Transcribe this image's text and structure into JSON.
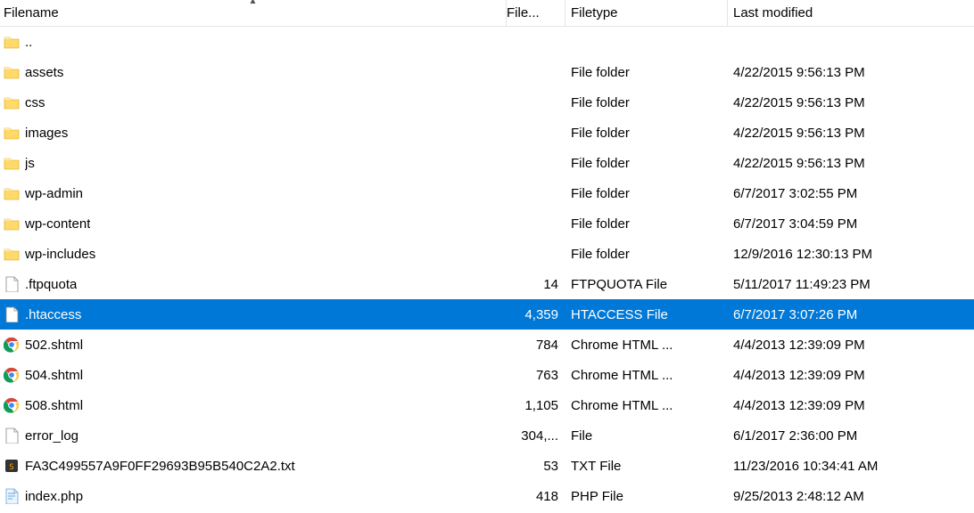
{
  "columns": {
    "filename": "Filename",
    "filesize": "File...",
    "filetype": "Filetype",
    "lastmod": "Last modified"
  },
  "sort_column": "filename",
  "sort_dir": "asc",
  "rows": [
    {
      "icon": "folder",
      "name": "..",
      "size": "",
      "type": "",
      "mod": "",
      "sel": false
    },
    {
      "icon": "folder",
      "name": "assets",
      "size": "",
      "type": "File folder",
      "mod": "4/22/2015 9:56:13 PM",
      "sel": false
    },
    {
      "icon": "folder",
      "name": "css",
      "size": "",
      "type": "File folder",
      "mod": "4/22/2015 9:56:13 PM",
      "sel": false
    },
    {
      "icon": "folder",
      "name": "images",
      "size": "",
      "type": "File folder",
      "mod": "4/22/2015 9:56:13 PM",
      "sel": false
    },
    {
      "icon": "folder",
      "name": "js",
      "size": "",
      "type": "File folder",
      "mod": "4/22/2015 9:56:13 PM",
      "sel": false
    },
    {
      "icon": "folder",
      "name": "wp-admin",
      "size": "",
      "type": "File folder",
      "mod": "6/7/2017 3:02:55 PM",
      "sel": false
    },
    {
      "icon": "folder",
      "name": "wp-content",
      "size": "",
      "type": "File folder",
      "mod": "6/7/2017 3:04:59 PM",
      "sel": false
    },
    {
      "icon": "folder",
      "name": "wp-includes",
      "size": "",
      "type": "File folder",
      "mod": "12/9/2016 12:30:13 PM",
      "sel": false
    },
    {
      "icon": "blank",
      "name": ".ftpquota",
      "size": "14",
      "type": "FTPQUOTA File",
      "mod": "5/11/2017 11:49:23 PM",
      "sel": false
    },
    {
      "icon": "blank",
      "name": ".htaccess",
      "size": "4,359",
      "type": "HTACCESS File",
      "mod": "6/7/2017 3:07:26 PM",
      "sel": true
    },
    {
      "icon": "chrome",
      "name": "502.shtml",
      "size": "784",
      "type": "Chrome HTML ...",
      "mod": "4/4/2013 12:39:09 PM",
      "sel": false
    },
    {
      "icon": "chrome",
      "name": "504.shtml",
      "size": "763",
      "type": "Chrome HTML ...",
      "mod": "4/4/2013 12:39:09 PM",
      "sel": false
    },
    {
      "icon": "chrome",
      "name": "508.shtml",
      "size": "1,105",
      "type": "Chrome HTML ...",
      "mod": "4/4/2013 12:39:09 PM",
      "sel": false
    },
    {
      "icon": "blank",
      "name": "error_log",
      "size": "304,...",
      "type": "File",
      "mod": "6/1/2017 2:36:00 PM",
      "sel": false
    },
    {
      "icon": "txt",
      "name": "FA3C499557A9F0FF29693B95B540C2A2.txt",
      "size": "53",
      "type": "TXT File",
      "mod": "11/23/2016 10:34:41 AM",
      "sel": false
    },
    {
      "icon": "php",
      "name": "index.php",
      "size": "418",
      "type": "PHP File",
      "mod": "9/25/2013 2:48:12 AM",
      "sel": false
    }
  ]
}
